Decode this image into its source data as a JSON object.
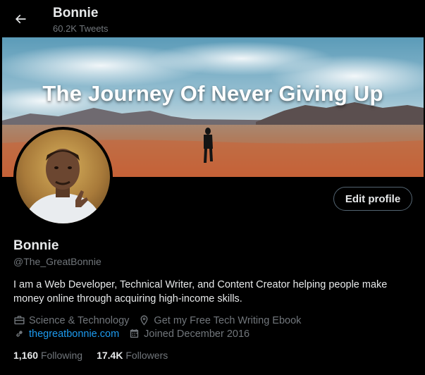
{
  "header": {
    "title": "Bonnie",
    "tweet_count": "60.2K Tweets"
  },
  "banner": {
    "text": "The Journey Of Never Giving Up"
  },
  "profile": {
    "name": "Bonnie",
    "handle": "@The_GreatBonnie",
    "bio": "I am a Web Developer, Technical Writer, and Content Creator helping people make money online through acquiring high-income skills.",
    "edit_label": "Edit profile",
    "category": "Science & Technology",
    "location": "Get my Free Tech Writing Ebook",
    "website": "thegreatbonnie.com",
    "joined": "Joined December 2016"
  },
  "stats": {
    "following_count": "1,160",
    "following_label": "Following",
    "followers_count": "17.4K",
    "followers_label": "Followers"
  },
  "colors": {
    "background": "#000000",
    "text_primary": "#e7e9ea",
    "text_secondary": "#71767b",
    "link": "#1d9bf0",
    "border": "#536471"
  },
  "icons": {
    "back": "arrow-left-icon",
    "category": "briefcase-icon",
    "location": "location-pin-icon",
    "website": "link-icon",
    "joined": "calendar-icon"
  }
}
